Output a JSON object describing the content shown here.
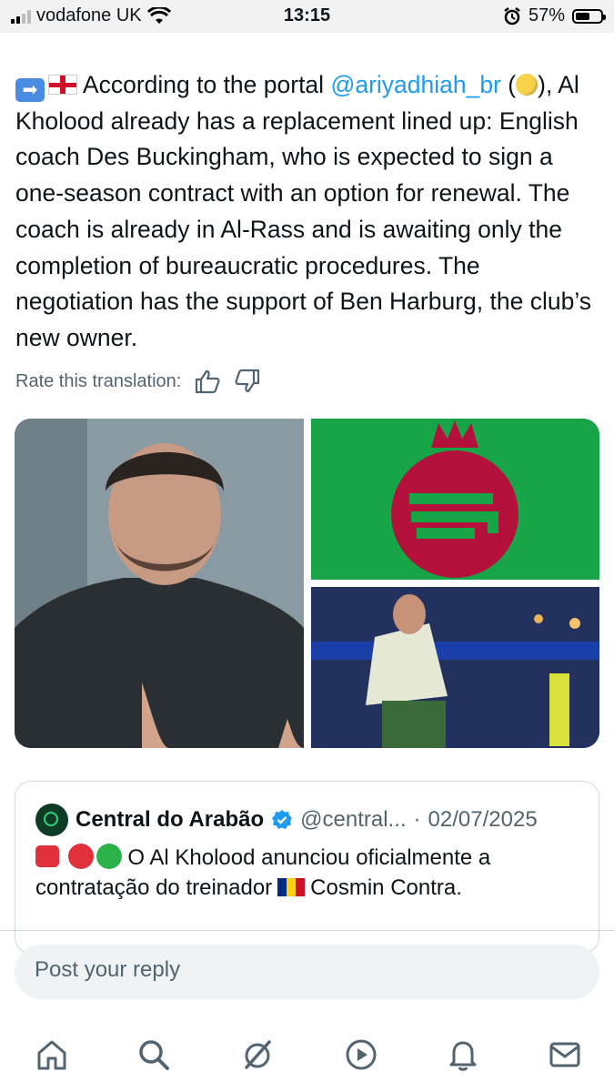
{
  "status_bar": {
    "carrier": "vodafone UK",
    "time": "13:15",
    "battery": "57%",
    "battery_level": 0.57
  },
  "tweet": {
    "text_prefix": "According to the portal",
    "mention": "@ariyadhiah_br",
    "text_body": "), Al Kholood already has a replacement lined up: English coach Des Buckingham, who is expected to sign a one-season contract with an option for renewal. The coach is already in Al-Rass and is awaiting only the completion of bureaucratic procedures. The negotiation has the support of Ben Harburg, the club’s new owner.",
    "open_paren": "("
  },
  "translation": {
    "rate_label": "Rate this translation:"
  },
  "quote": {
    "name": "Central do Arabão",
    "handle": "@central...",
    "sep": "·",
    "date": "02/07/2025",
    "text_part1": "O Al Kholood anunciou oficialmente a contratação do treinador",
    "text_part2": "Cosmin Contra."
  },
  "reply": {
    "placeholder": "Post your reply"
  },
  "tabs": [
    "home-icon",
    "search-icon",
    "grok-icon",
    "video-icon",
    "notifications-icon",
    "messages-icon"
  ],
  "colors": {
    "accent": "#1d9bf0",
    "text": "#0f1419",
    "muted": "#536471",
    "club_green": "#17a548",
    "club_red": "#b3103c"
  }
}
